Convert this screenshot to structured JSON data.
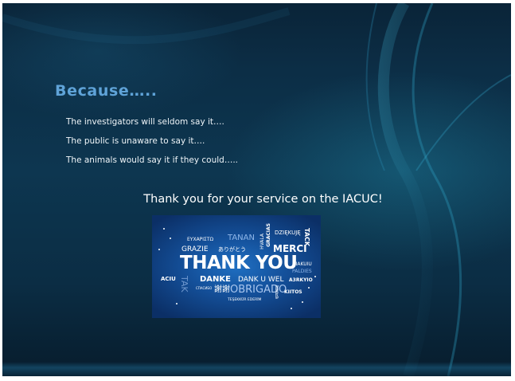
{
  "slide": {
    "title": "Because…..",
    "reasons": [
      "The investigators will seldom say it….",
      "The public is unaware to say it….",
      "The animals would say it if they could….."
    ],
    "thanks_line": "Thank you for your service on the IACUC!"
  },
  "image": {
    "words": {
      "eucharisto": "ΕΥΧΑΡΙΣΤΩ",
      "tanan": "TANAN",
      "hvala": "HVALA",
      "gracias": "GRACIAS",
      "dziekuje": "DZIĘKUJĘ",
      "grazie": "GRAZIE",
      "arigatou": "ありがとう",
      "merci": "MERCI",
      "tack": "TACK",
      "thank_you": "THANK YOU",
      "diakuiu": "DIAKUIU",
      "paldies": "PALDIES",
      "aciu": "ACIU",
      "tak": "TAK",
      "danke": "DANKE",
      "dank_u_wel": "DANK U WEL",
      "azerkyio": "A3RKYIO",
      "spasibo": "СПАСИБО",
      "xiexie": "謝謝",
      "obrigado": "OBRIGADO",
      "kiitos": "KIITOS",
      "dhanyavad": "धन्यवाद",
      "tesekkur": "TEŞEKKÜR EDERİM"
    }
  },
  "colors": {
    "title": "#5fa3d8",
    "body_text": "#eef4f8",
    "background": "#0d3650",
    "card": "#14509a"
  }
}
